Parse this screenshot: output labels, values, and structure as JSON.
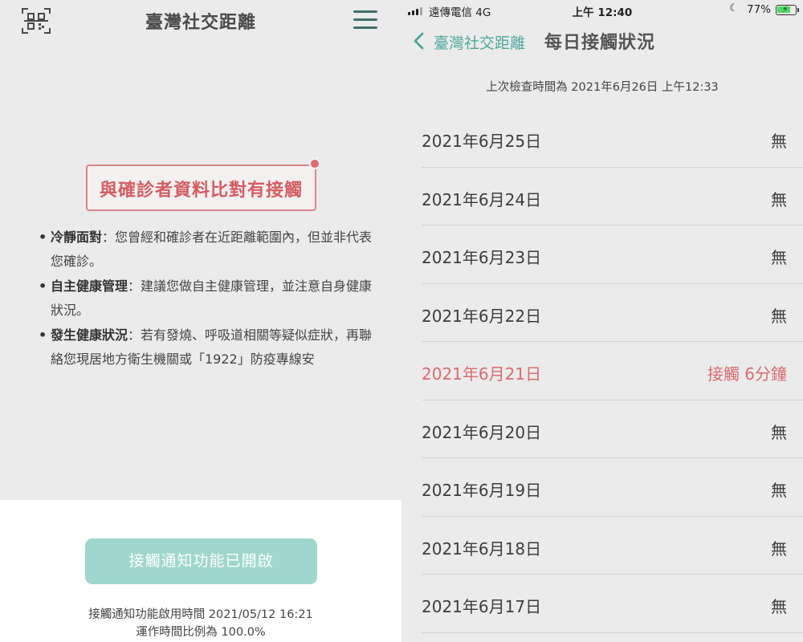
{
  "left": {
    "header": {
      "title": "臺灣社交距離",
      "qr_icon": "qr-code-icon",
      "menu_icon": "hamburger-menu-icon"
    },
    "alert": {
      "text": "與確診者資料比對有接觸"
    },
    "tips": [
      {
        "title": "冷靜面對",
        "body": "：您曾經和確診者在近距離範圍內，但並非代表您確診。"
      },
      {
        "title": "自主健康管理",
        "body": "：建議您做自主健康管理，並注意自身健康狀況。"
      },
      {
        "title": "發生健康狀況",
        "body": "：若有發燒、呼吸道相關等疑似症狀，再聯絡您現居地方衛生機關或「1922」防疫專線安"
      }
    ],
    "notify_button": "接觸通知功能已開啟",
    "enable_time": "接觸通知功能啟用時間 2021/05/12 16:21",
    "run_ratio": "運作時間比例為 100.0%"
  },
  "right": {
    "status_bar": {
      "carrier": "遠傳電信  4G",
      "time": "上午 12:40",
      "battery": "77%",
      "battery_level": 0.77
    },
    "nav": {
      "back_label": "臺灣社交距離",
      "title": "每日接觸狀況"
    },
    "last_check": "上次檢查時間為 2021年6月26日 上午12:33",
    "days": [
      {
        "date": "2021年6月25日",
        "status": "無",
        "contact": false
      },
      {
        "date": "2021年6月24日",
        "status": "無",
        "contact": false
      },
      {
        "date": "2021年6月23日",
        "status": "無",
        "contact": false
      },
      {
        "date": "2021年6月22日",
        "status": "無",
        "contact": false
      },
      {
        "date": "2021年6月21日",
        "status": "接觸 6分鐘",
        "contact": true
      },
      {
        "date": "2021年6月20日",
        "status": "無",
        "contact": false
      },
      {
        "date": "2021年6月19日",
        "status": "無",
        "contact": false
      },
      {
        "date": "2021年6月18日",
        "status": "無",
        "contact": false
      },
      {
        "date": "2021年6月17日",
        "status": "無",
        "contact": false
      }
    ]
  },
  "colors": {
    "accent": "#4ea79a",
    "alert": "#d55d62",
    "button": "#9fd7cf"
  }
}
